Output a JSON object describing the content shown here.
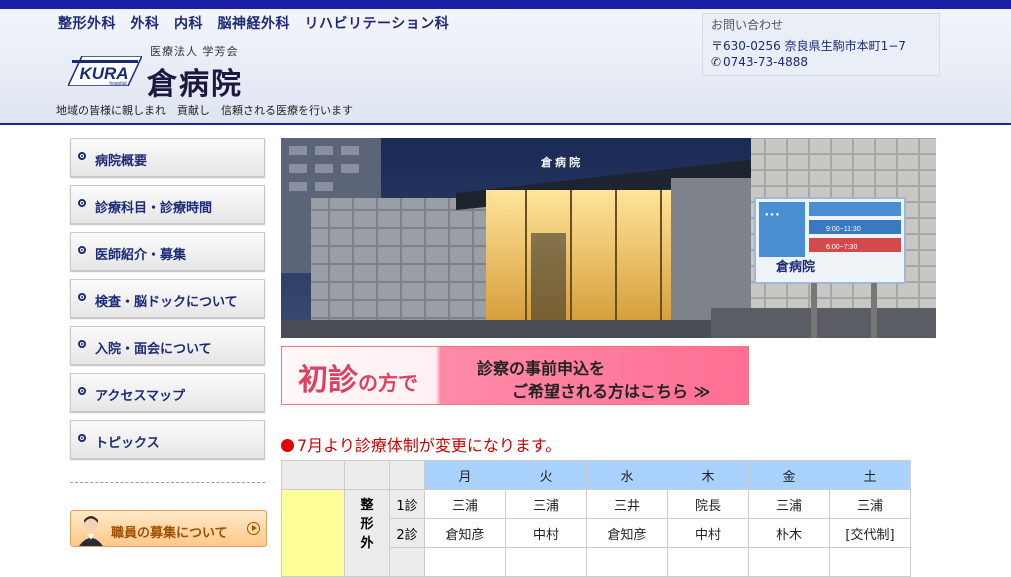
{
  "header": {
    "departments": "整形外科　外科　内科　脳神経外科　リハビリテーション科",
    "corporation": "医療法人 学芳会",
    "hospital_name": "倉病院",
    "logo_text": "KURA",
    "logo_sub": "hospital",
    "tagline": "地域の皆様に親しまれ　貢献し　信頼される医療を行います",
    "contact": {
      "title": "お問い合わせ",
      "address": "630-0256 奈良県生駒市本町1−7",
      "phone": "0743-73-4888"
    }
  },
  "sidebar": {
    "items": [
      {
        "label": "病院概要"
      },
      {
        "label": "診療科目・診療時間"
      },
      {
        "label": "医師紹介・募集"
      },
      {
        "label": "検査・脳ドックについて"
      },
      {
        "label": "入院・面会について"
      },
      {
        "label": "アクセスマップ"
      },
      {
        "label": "トピックス"
      }
    ],
    "recruit_label": "職員の募集について"
  },
  "photo": {
    "sign_text": "倉 病 院",
    "board_title": "倉病院",
    "board_hours_1": "9:00~11:30",
    "board_hours_2": "6:00~7:30"
  },
  "banner": {
    "left_big": "初診",
    "left_small": "の方で",
    "right_line1": "診察の事前申込を",
    "right_line2": "ご希望される方はこちら ≫"
  },
  "notice": "7月より診療体制が変更になります。",
  "schedule": {
    "days": [
      "月",
      "火",
      "水",
      "木",
      "金",
      "土"
    ],
    "department": "整形外",
    "rows": [
      {
        "slot": "1診",
        "cells": [
          "三浦",
          "三浦",
          "三井",
          "院長",
          "三浦",
          "三浦"
        ]
      },
      {
        "slot": "2診",
        "cells": [
          "倉知彦",
          "中村",
          "倉知彦",
          "中村",
          "朴木",
          "[交代制]"
        ]
      }
    ]
  },
  "colors": {
    "navy": "#1a2a78",
    "topbar": "#1a1fa6",
    "day_header": "#a9d2ff",
    "notice_red": "#d00000",
    "banner_pink": "#ff6f94"
  }
}
